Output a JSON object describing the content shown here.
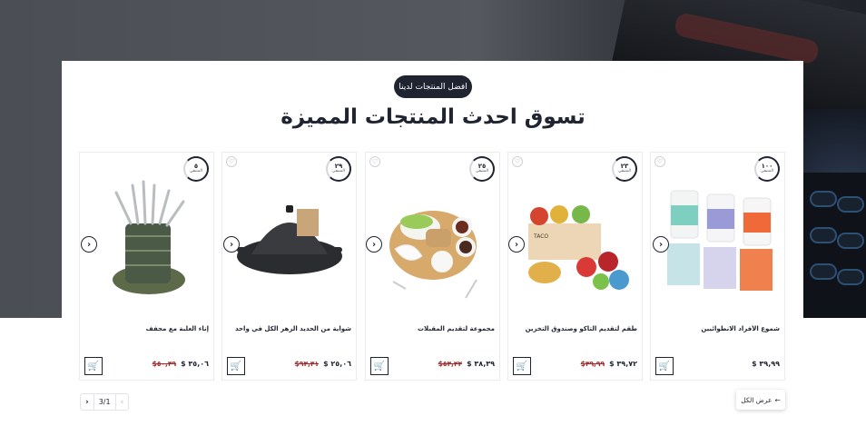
{
  "section": {
    "badge": "افضل المنتجات لدينا",
    "title": "تسوق احدث المنتجات المميزة"
  },
  "products": [
    {
      "name": "شموع الأفراد الانطوائيين",
      "price": "$ ٣٩,٩٩",
      "old_price": "",
      "badge_number": "١٠٠",
      "badge_unit": "المتبقي"
    },
    {
      "name": "طقم لتقديم التاكو وصندوق التخزين",
      "price": "$ ٣٩,٧٢",
      "old_price": "$٣٩,٩٩",
      "badge_number": "٢٣",
      "badge_unit": "المتبقي"
    },
    {
      "name": "مجموعة لتقديم المقبلات",
      "price": "$ ٣٨,٣٩",
      "old_price": "$٥٣,٢٢",
      "badge_number": "٢٥",
      "badge_unit": "المتبقي"
    },
    {
      "name": "شواية من الحديد الزهر الكل في واحد",
      "price": "$ ٢٥,٠٦",
      "old_price": "$٩٣,٣١",
      "badge_number": "٢٩",
      "badge_unit": "المتبقي"
    },
    {
      "name": "إناء العلبة مع مجفف",
      "price": "$ ٣٥,٠٦",
      "old_price": "$٥٠,٣٩",
      "badge_number": "٥",
      "badge_unit": "المتبقي"
    }
  ],
  "pagination": {
    "prev": "‹",
    "count": "3/1",
    "next": "›"
  },
  "view_all": {
    "label": "عرض الكل",
    "icon": "arrow-left-icon"
  },
  "icons": {
    "wishlist": "heart-icon",
    "cart": "cart-icon",
    "next": "chevron-right-icon"
  },
  "colors": {
    "dark": "#1f2430",
    "sale": "#a12a2a",
    "hero": "#4b4e55"
  }
}
